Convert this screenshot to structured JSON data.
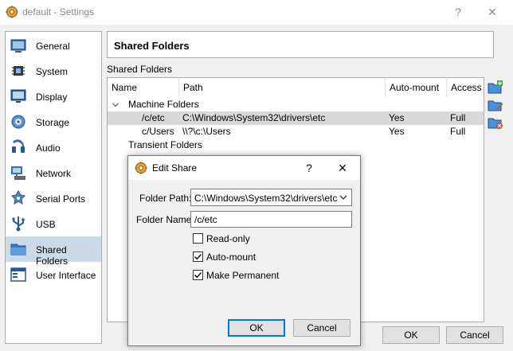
{
  "window": {
    "title": "default - Settings",
    "help_glyph": "?",
    "close_glyph": "✕"
  },
  "sidebar": {
    "items": [
      {
        "label": "General",
        "icon": "general-icon"
      },
      {
        "label": "System",
        "icon": "system-icon"
      },
      {
        "label": "Display",
        "icon": "display-icon"
      },
      {
        "label": "Storage",
        "icon": "storage-icon"
      },
      {
        "label": "Audio",
        "icon": "audio-icon"
      },
      {
        "label": "Network",
        "icon": "network-icon"
      },
      {
        "label": "Serial Ports",
        "icon": "serial-ports-icon"
      },
      {
        "label": "USB",
        "icon": "usb-icon"
      },
      {
        "label": "Shared Folders",
        "icon": "shared-folders-icon",
        "active": true
      },
      {
        "label": "User Interface",
        "icon": "user-interface-icon"
      }
    ]
  },
  "page": {
    "title": "Shared Folders",
    "group_label": "Shared Folders"
  },
  "table": {
    "columns": [
      "Name",
      "Path",
      "Auto-mount",
      "Access"
    ],
    "machine_group": "Machine Folders",
    "transient_group": "Transient Folders",
    "rows": [
      {
        "name": "/c/etc",
        "path": "C:\\Windows\\System32\\drivers\\etc",
        "automount": "Yes",
        "access": "Full",
        "selected": true
      },
      {
        "name": "c/Users",
        "path": "\\\\?\\c:\\Users",
        "automount": "Yes",
        "access": "Full",
        "selected": false
      }
    ]
  },
  "actions": {
    "add": "add-folder-icon",
    "edit": "edit-folder-icon",
    "remove": "remove-folder-icon"
  },
  "buttons": {
    "ok": "OK",
    "cancel": "Cancel"
  },
  "dialog": {
    "title": "Edit Share",
    "help_glyph": "?",
    "close_glyph": "✕",
    "folder_path_label": "Folder Path:",
    "folder_path_value": "C:\\Windows\\System32\\drivers\\etc",
    "folder_name_label": "Folder Name:",
    "folder_name_value": "/c/etc",
    "readonly_label": "Read-only",
    "readonly_checked": false,
    "automount_label": "Auto-mount",
    "automount_checked": true,
    "permanent_label": "Make Permanent",
    "permanent_checked": true,
    "ok": "OK",
    "cancel": "Cancel"
  },
  "colors": {
    "selection": "#ccd9e7",
    "row_selected": "#d9d9d9",
    "focus_border": "#0078d7"
  }
}
